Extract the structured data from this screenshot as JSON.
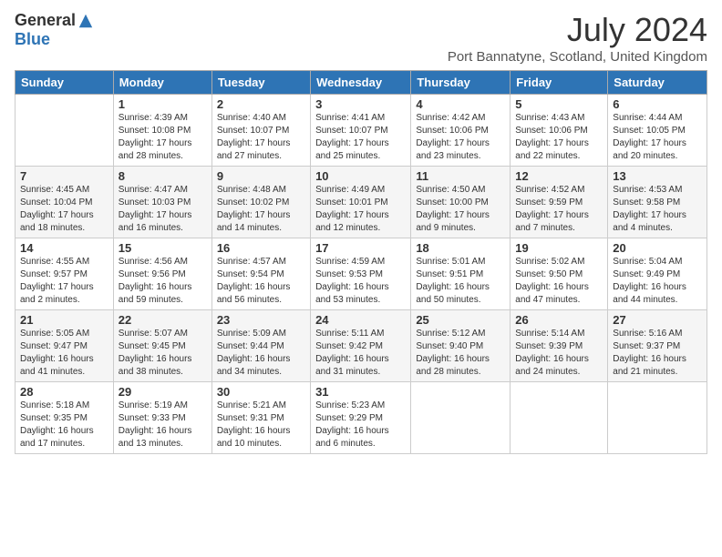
{
  "header": {
    "logo_general": "General",
    "logo_blue": "Blue",
    "title": "July 2024",
    "location": "Port Bannatyne, Scotland, United Kingdom"
  },
  "days_of_week": [
    "Sunday",
    "Monday",
    "Tuesday",
    "Wednesday",
    "Thursday",
    "Friday",
    "Saturday"
  ],
  "weeks": [
    [
      {
        "day": "",
        "info": ""
      },
      {
        "day": "1",
        "info": "Sunrise: 4:39 AM\nSunset: 10:08 PM\nDaylight: 17 hours\nand 28 minutes."
      },
      {
        "day": "2",
        "info": "Sunrise: 4:40 AM\nSunset: 10:07 PM\nDaylight: 17 hours\nand 27 minutes."
      },
      {
        "day": "3",
        "info": "Sunrise: 4:41 AM\nSunset: 10:07 PM\nDaylight: 17 hours\nand 25 minutes."
      },
      {
        "day": "4",
        "info": "Sunrise: 4:42 AM\nSunset: 10:06 PM\nDaylight: 17 hours\nand 23 minutes."
      },
      {
        "day": "5",
        "info": "Sunrise: 4:43 AM\nSunset: 10:06 PM\nDaylight: 17 hours\nand 22 minutes."
      },
      {
        "day": "6",
        "info": "Sunrise: 4:44 AM\nSunset: 10:05 PM\nDaylight: 17 hours\nand 20 minutes."
      }
    ],
    [
      {
        "day": "7",
        "info": "Sunrise: 4:45 AM\nSunset: 10:04 PM\nDaylight: 17 hours\nand 18 minutes."
      },
      {
        "day": "8",
        "info": "Sunrise: 4:47 AM\nSunset: 10:03 PM\nDaylight: 17 hours\nand 16 minutes."
      },
      {
        "day": "9",
        "info": "Sunrise: 4:48 AM\nSunset: 10:02 PM\nDaylight: 17 hours\nand 14 minutes."
      },
      {
        "day": "10",
        "info": "Sunrise: 4:49 AM\nSunset: 10:01 PM\nDaylight: 17 hours\nand 12 minutes."
      },
      {
        "day": "11",
        "info": "Sunrise: 4:50 AM\nSunset: 10:00 PM\nDaylight: 17 hours\nand 9 minutes."
      },
      {
        "day": "12",
        "info": "Sunrise: 4:52 AM\nSunset: 9:59 PM\nDaylight: 17 hours\nand 7 minutes."
      },
      {
        "day": "13",
        "info": "Sunrise: 4:53 AM\nSunset: 9:58 PM\nDaylight: 17 hours\nand 4 minutes."
      }
    ],
    [
      {
        "day": "14",
        "info": "Sunrise: 4:55 AM\nSunset: 9:57 PM\nDaylight: 17 hours\nand 2 minutes."
      },
      {
        "day": "15",
        "info": "Sunrise: 4:56 AM\nSunset: 9:56 PM\nDaylight: 16 hours\nand 59 minutes."
      },
      {
        "day": "16",
        "info": "Sunrise: 4:57 AM\nSunset: 9:54 PM\nDaylight: 16 hours\nand 56 minutes."
      },
      {
        "day": "17",
        "info": "Sunrise: 4:59 AM\nSunset: 9:53 PM\nDaylight: 16 hours\nand 53 minutes."
      },
      {
        "day": "18",
        "info": "Sunrise: 5:01 AM\nSunset: 9:51 PM\nDaylight: 16 hours\nand 50 minutes."
      },
      {
        "day": "19",
        "info": "Sunrise: 5:02 AM\nSunset: 9:50 PM\nDaylight: 16 hours\nand 47 minutes."
      },
      {
        "day": "20",
        "info": "Sunrise: 5:04 AM\nSunset: 9:49 PM\nDaylight: 16 hours\nand 44 minutes."
      }
    ],
    [
      {
        "day": "21",
        "info": "Sunrise: 5:05 AM\nSunset: 9:47 PM\nDaylight: 16 hours\nand 41 minutes."
      },
      {
        "day": "22",
        "info": "Sunrise: 5:07 AM\nSunset: 9:45 PM\nDaylight: 16 hours\nand 38 minutes."
      },
      {
        "day": "23",
        "info": "Sunrise: 5:09 AM\nSunset: 9:44 PM\nDaylight: 16 hours\nand 34 minutes."
      },
      {
        "day": "24",
        "info": "Sunrise: 5:11 AM\nSunset: 9:42 PM\nDaylight: 16 hours\nand 31 minutes."
      },
      {
        "day": "25",
        "info": "Sunrise: 5:12 AM\nSunset: 9:40 PM\nDaylight: 16 hours\nand 28 minutes."
      },
      {
        "day": "26",
        "info": "Sunrise: 5:14 AM\nSunset: 9:39 PM\nDaylight: 16 hours\nand 24 minutes."
      },
      {
        "day": "27",
        "info": "Sunrise: 5:16 AM\nSunset: 9:37 PM\nDaylight: 16 hours\nand 21 minutes."
      }
    ],
    [
      {
        "day": "28",
        "info": "Sunrise: 5:18 AM\nSunset: 9:35 PM\nDaylight: 16 hours\nand 17 minutes."
      },
      {
        "day": "29",
        "info": "Sunrise: 5:19 AM\nSunset: 9:33 PM\nDaylight: 16 hours\nand 13 minutes."
      },
      {
        "day": "30",
        "info": "Sunrise: 5:21 AM\nSunset: 9:31 PM\nDaylight: 16 hours\nand 10 minutes."
      },
      {
        "day": "31",
        "info": "Sunrise: 5:23 AM\nSunset: 9:29 PM\nDaylight: 16 hours\nand 6 minutes."
      },
      {
        "day": "",
        "info": ""
      },
      {
        "day": "",
        "info": ""
      },
      {
        "day": "",
        "info": ""
      }
    ]
  ]
}
